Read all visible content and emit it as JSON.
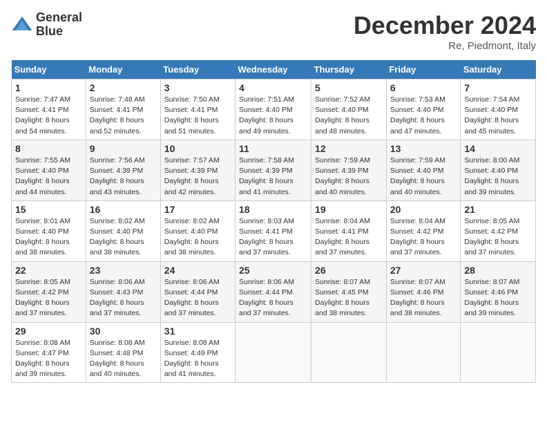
{
  "header": {
    "logo_line1": "General",
    "logo_line2": "Blue",
    "month": "December 2024",
    "location": "Re, Piedmont, Italy"
  },
  "weekdays": [
    "Sunday",
    "Monday",
    "Tuesday",
    "Wednesday",
    "Thursday",
    "Friday",
    "Saturday"
  ],
  "weeks": [
    [
      {
        "day": "1",
        "sunrise": "7:47 AM",
        "sunset": "4:41 PM",
        "daylight": "8 hours and 54 minutes."
      },
      {
        "day": "2",
        "sunrise": "7:48 AM",
        "sunset": "4:41 PM",
        "daylight": "8 hours and 52 minutes."
      },
      {
        "day": "3",
        "sunrise": "7:50 AM",
        "sunset": "4:41 PM",
        "daylight": "8 hours and 51 minutes."
      },
      {
        "day": "4",
        "sunrise": "7:51 AM",
        "sunset": "4:40 PM",
        "daylight": "8 hours and 49 minutes."
      },
      {
        "day": "5",
        "sunrise": "7:52 AM",
        "sunset": "4:40 PM",
        "daylight": "8 hours and 48 minutes."
      },
      {
        "day": "6",
        "sunrise": "7:53 AM",
        "sunset": "4:40 PM",
        "daylight": "8 hours and 47 minutes."
      },
      {
        "day": "7",
        "sunrise": "7:54 AM",
        "sunset": "4:40 PM",
        "daylight": "8 hours and 45 minutes."
      }
    ],
    [
      {
        "day": "8",
        "sunrise": "7:55 AM",
        "sunset": "4:40 PM",
        "daylight": "8 hours and 44 minutes."
      },
      {
        "day": "9",
        "sunrise": "7:56 AM",
        "sunset": "4:39 PM",
        "daylight": "8 hours and 43 minutes."
      },
      {
        "day": "10",
        "sunrise": "7:57 AM",
        "sunset": "4:39 PM",
        "daylight": "8 hours and 42 minutes."
      },
      {
        "day": "11",
        "sunrise": "7:58 AM",
        "sunset": "4:39 PM",
        "daylight": "8 hours and 41 minutes."
      },
      {
        "day": "12",
        "sunrise": "7:59 AM",
        "sunset": "4:39 PM",
        "daylight": "8 hours and 40 minutes."
      },
      {
        "day": "13",
        "sunrise": "7:59 AM",
        "sunset": "4:40 PM",
        "daylight": "8 hours and 40 minutes."
      },
      {
        "day": "14",
        "sunrise": "8:00 AM",
        "sunset": "4:40 PM",
        "daylight": "8 hours and 39 minutes."
      }
    ],
    [
      {
        "day": "15",
        "sunrise": "8:01 AM",
        "sunset": "4:40 PM",
        "daylight": "8 hours and 38 minutes."
      },
      {
        "day": "16",
        "sunrise": "8:02 AM",
        "sunset": "4:40 PM",
        "daylight": "8 hours and 38 minutes."
      },
      {
        "day": "17",
        "sunrise": "8:02 AM",
        "sunset": "4:40 PM",
        "daylight": "8 hours and 38 minutes."
      },
      {
        "day": "18",
        "sunrise": "8:03 AM",
        "sunset": "4:41 PM",
        "daylight": "8 hours and 37 minutes."
      },
      {
        "day": "19",
        "sunrise": "8:04 AM",
        "sunset": "4:41 PM",
        "daylight": "8 hours and 37 minutes."
      },
      {
        "day": "20",
        "sunrise": "8:04 AM",
        "sunset": "4:42 PM",
        "daylight": "8 hours and 37 minutes."
      },
      {
        "day": "21",
        "sunrise": "8:05 AM",
        "sunset": "4:42 PM",
        "daylight": "8 hours and 37 minutes."
      }
    ],
    [
      {
        "day": "22",
        "sunrise": "8:05 AM",
        "sunset": "4:42 PM",
        "daylight": "8 hours and 37 minutes."
      },
      {
        "day": "23",
        "sunrise": "8:06 AM",
        "sunset": "4:43 PM",
        "daylight": "8 hours and 37 minutes."
      },
      {
        "day": "24",
        "sunrise": "8:06 AM",
        "sunset": "4:44 PM",
        "daylight": "8 hours and 37 minutes."
      },
      {
        "day": "25",
        "sunrise": "8:06 AM",
        "sunset": "4:44 PM",
        "daylight": "8 hours and 37 minutes."
      },
      {
        "day": "26",
        "sunrise": "8:07 AM",
        "sunset": "4:45 PM",
        "daylight": "8 hours and 38 minutes."
      },
      {
        "day": "27",
        "sunrise": "8:07 AM",
        "sunset": "4:46 PM",
        "daylight": "8 hours and 38 minutes."
      },
      {
        "day": "28",
        "sunrise": "8:07 AM",
        "sunset": "4:46 PM",
        "daylight": "8 hours and 39 minutes."
      }
    ],
    [
      {
        "day": "29",
        "sunrise": "8:08 AM",
        "sunset": "4:47 PM",
        "daylight": "8 hours and 39 minutes."
      },
      {
        "day": "30",
        "sunrise": "8:08 AM",
        "sunset": "4:48 PM",
        "daylight": "8 hours and 40 minutes."
      },
      {
        "day": "31",
        "sunrise": "8:08 AM",
        "sunset": "4:49 PM",
        "daylight": "8 hours and 41 minutes."
      },
      null,
      null,
      null,
      null
    ]
  ]
}
